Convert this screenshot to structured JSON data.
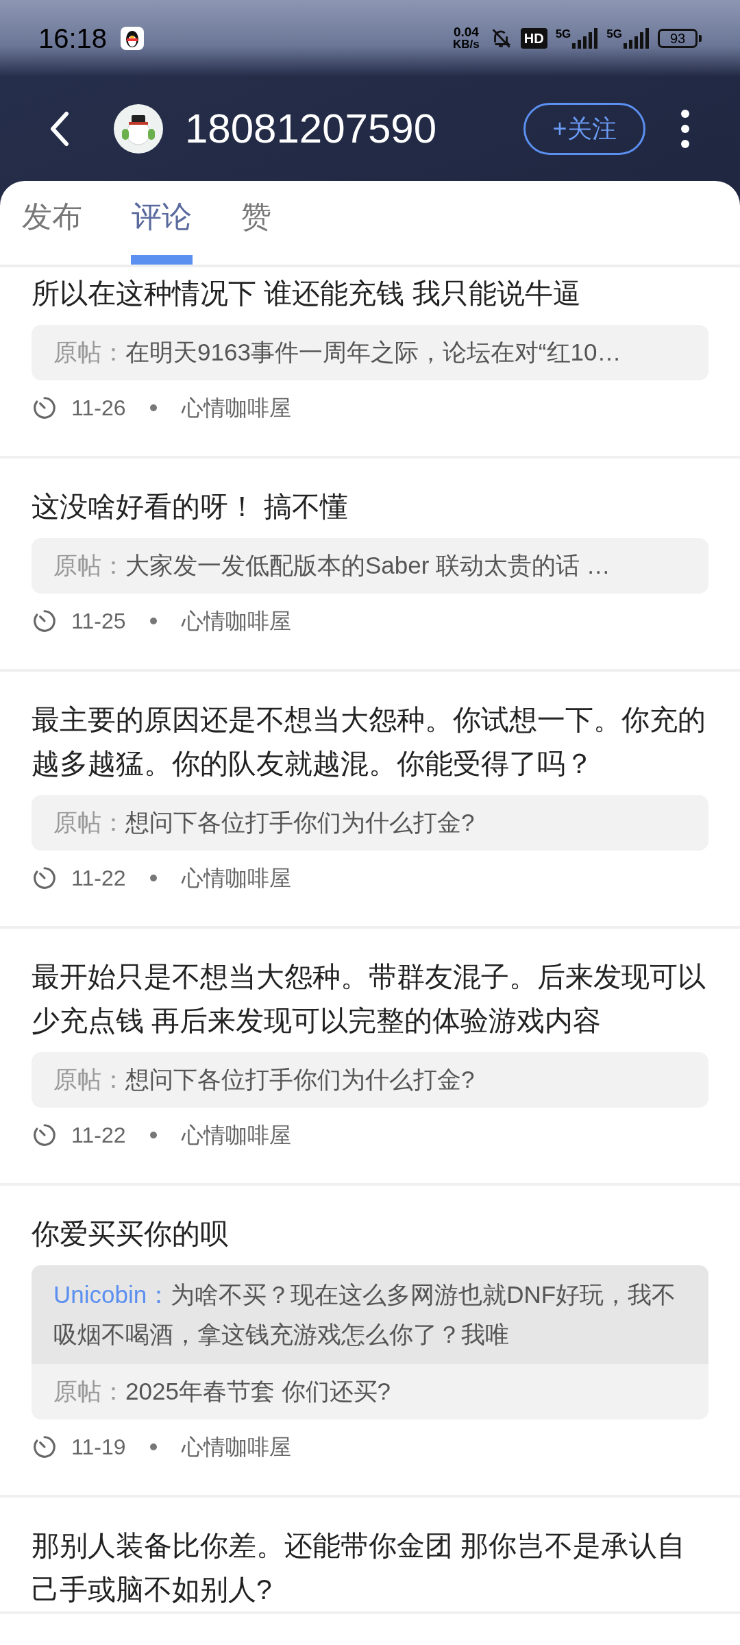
{
  "status_bar": {
    "time": "16:18",
    "net_speed": "0.04",
    "net_unit": "KB/s",
    "hd": "HD",
    "network_1": "5G",
    "network_2": "5G",
    "battery": "93"
  },
  "header": {
    "username": "18081207590",
    "follow_button": "+关注"
  },
  "tabs": [
    {
      "label": "发布",
      "selected": false
    },
    {
      "label": "评论",
      "selected": true
    },
    {
      "label": "赞",
      "selected": false
    }
  ],
  "comments": [
    {
      "text": "所以在这种情况下 谁还能充钱 我只能说牛逼",
      "origin_label": "原帖：",
      "origin": "在明天9163事件一周年之际，论坛在对“红10…",
      "date": "11-26",
      "board": "心情咖啡屋"
    },
    {
      "text": "这没啥好看的呀！  搞不懂",
      "origin_label": "原帖：",
      "origin": "大家发一发低配版本的Saber 联动太贵的话 …",
      "date": "11-25",
      "board": "心情咖啡屋"
    },
    {
      "text": "最主要的原因还是不想当大怨种。你试想一下。你充的越多越猛。你的队友就越混。你能受得了吗？",
      "origin_label": "原帖：",
      "origin": "想问下各位打手你们为什么打金?",
      "date": "11-22",
      "board": "心情咖啡屋"
    },
    {
      "text": "最开始只是不想当大怨种。带群友混子。后来发现可以少充点钱 再后来发现可以完整的体验游戏内容",
      "origin_label": "原帖：",
      "origin": "想问下各位打手你们为什么打金?",
      "date": "11-22",
      "board": "心情咖啡屋"
    },
    {
      "text": "你爱买买你的呗",
      "reply_user": "Unicobin：",
      "reply": "为啥不买？现在这么多网游也就DNF好玩，我不吸烟不喝酒，拿这钱充游戏怎么你了？我唯",
      "origin_label": "原帖：",
      "origin": "2025年春节套 你们还买?",
      "date": "11-19",
      "board": "心情咖啡屋"
    },
    {
      "text": "那别人装备比你差。还能带你金团 那你岂不是承认自己手或脑不如别人?"
    }
  ]
}
